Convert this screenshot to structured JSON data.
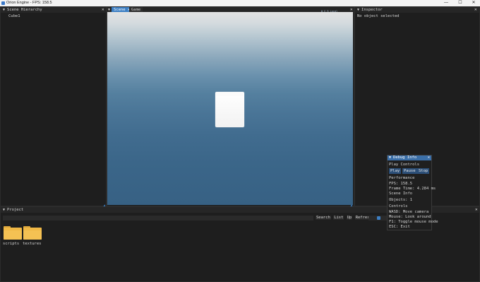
{
  "window": {
    "title": "Orion Engine - FPS: 158.5",
    "minimize": "—",
    "maximize": "☐",
    "close": "✕"
  },
  "hierarchy": {
    "title": "Scene Hierarchy",
    "close": "✕",
    "items": [
      "Cube1"
    ]
  },
  "scene_tabs": {
    "tabs": [
      {
        "label": "Scene",
        "close": "✕"
      },
      {
        "label": "Game"
      }
    ],
    "close": "✕",
    "gizmo": [
      "W",
      "E",
      "R",
      "Local"
    ]
  },
  "inspector": {
    "title": "Inspector",
    "close": "✕",
    "empty": "No object selected"
  },
  "debug": {
    "title": "Debug Info",
    "close": "✕",
    "play_controls": "Play Controls",
    "buttons": [
      "Play",
      "Pause",
      "Stop"
    ],
    "performance": "Performance",
    "fps": "FPS: 158.5",
    "frame_time": "Frame Time: 4.284 ms",
    "scene_info": "Scene Info",
    "objects": "Objects: 1",
    "controls": "Controls",
    "wasd": "WASD: Move camera",
    "mouse": "Mouse: Look around",
    "f1": "F1: Toggle mouse mode",
    "esc": "ESC: Exit"
  },
  "project": {
    "title": "Project",
    "close": "✕",
    "search_placeholder": "",
    "toolbar": [
      "Search",
      "List",
      "Up",
      "Refresh"
    ],
    "folders": [
      "scripts",
      "textures"
    ]
  },
  "colors": {
    "accent": "#3c7fc4",
    "folder": "#f0b845",
    "panel": "#1e1e1e"
  }
}
